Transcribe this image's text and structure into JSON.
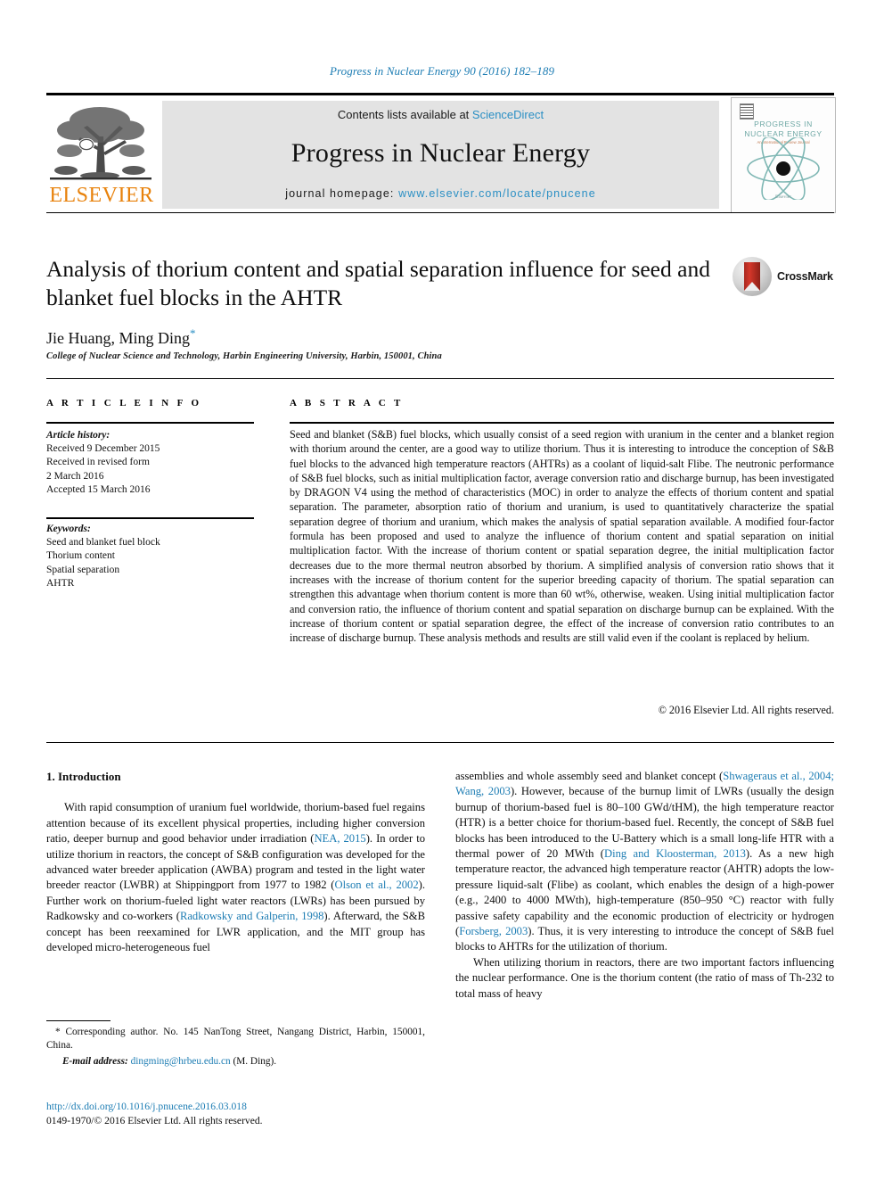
{
  "running_head": "Progress in Nuclear Energy 90 (2016) 182–189",
  "masthead": {
    "contents_prefix": "Contents lists available at ",
    "sciencedirect": "ScienceDirect",
    "journal_title": "Progress in Nuclear Energy",
    "homepage_prefix": "journal homepage: ",
    "homepage_url": "www.elsevier.com/locate/pnucene",
    "publisher": "ELSEVIER",
    "cover": {
      "line1": "PROGRESS IN",
      "line2": "NUCLEAR ENERGY",
      "subtitle": "An International Review Journal",
      "publisher_mark": "Elsevier"
    },
    "sciencedirect_color": "#2a8fc4",
    "elsevier_orange": "#e8820c",
    "banner_bg": "#e3e3e3"
  },
  "article": {
    "title": "Analysis of thorium content and spatial separation influence for seed and blanket fuel blocks in the AHTR",
    "authors": "Jie Huang, Ming Ding",
    "corresponding_marker": "*",
    "affiliation": "College of Nuclear Science and Technology, Harbin Engineering University, Harbin, 150001, China",
    "crossmark_label": "CrossMark"
  },
  "info": {
    "heading": "A R T I C L E  I N F O",
    "history_label": "Article history:",
    "history": [
      "Received 9 December 2015",
      "Received in revised form",
      "2 March 2016",
      "Accepted 15 March 2016"
    ],
    "keywords_label": "Keywords:",
    "keywords": [
      "Seed and blanket fuel block",
      "Thorium content",
      "Spatial separation",
      "AHTR"
    ]
  },
  "abstract": {
    "heading": "A B S T R A C T",
    "text": "Seed and blanket (S&B) fuel blocks, which usually consist of a seed region with uranium in the center and a blanket region with thorium around the center, are a good way to utilize thorium. Thus it is interesting to introduce the conception of S&B fuel blocks to the advanced high temperature reactors (AHTRs) as a coolant of liquid-salt Flibe. The neutronic performance of S&B fuel blocks, such as initial multiplication factor, average conversion ratio and discharge burnup, has been investigated by DRAGON V4 using the method of characteristics (MOC) in order to analyze the effects of thorium content and spatial separation. The parameter, absorption ratio of thorium and uranium, is used to quantitatively characterize the spatial separation degree of thorium and uranium, which makes the analysis of spatial separation available. A modified four-factor formula has been proposed and used to analyze the influence of thorium content and spatial separation on initial multiplication factor. With the increase of thorium content or spatial separation degree, the initial multiplication factor decreases due to the more thermal neutron absorbed by thorium. A simplified analysis of conversion ratio shows that it increases with the increase of thorium content for the superior breeding capacity of thorium. The spatial separation can strengthen this advantage when thorium content is more than 60 wt%, otherwise, weaken. Using initial multiplication factor and conversion ratio, the influence of thorium content and spatial separation on discharge burnup can be explained. With the increase of thorium content or spatial separation degree, the effect of the increase of conversion ratio contributes to an increase of discharge burnup. These analysis methods and results are still valid even if the coolant is replaced by helium.",
    "copyright": "© 2016 Elsevier Ltd. All rights reserved."
  },
  "body": {
    "section_number_title": "1. Introduction",
    "left_paragraph_1_a": "With rapid consumption of uranium fuel worldwide, thorium-based fuel regains attention because of its excellent physical properties, including higher conversion ratio, deeper burnup and good behavior under irradiation (",
    "ref_nea": "NEA, 2015",
    "left_paragraph_1_b": "). In order to utilize thorium in reactors, the concept of S&B configuration was developed for the advanced water breeder application (AWBA) program and tested in the light water breeder reactor (LWBR) at Shippingport from 1977 to 1982 (",
    "ref_olson": "Olson et al., 2002",
    "left_paragraph_1_c": "). Further work on thorium-fueled light water reactors (LWRs) has been pursued by Radkowsky and co-workers (",
    "ref_radkowsky": "Radkowsky and Galperin, 1998",
    "left_paragraph_1_d": "). Afterward, the S&B concept has been reexamined for LWR application, and the MIT group has developed micro-heterogeneous fuel",
    "right_paragraph_1_a": "assemblies and whole assembly seed and blanket concept (",
    "ref_shwageraus": "Shwageraus et al., 2004; Wang, 2003",
    "right_paragraph_1_b": "). However, because of the burnup limit of LWRs (usually the design burnup of thorium-based fuel is 80–100 GWd/tHM), the high temperature reactor (HTR) is a better choice for thorium-based fuel. Recently, the concept of S&B fuel blocks has been introduced to the U-Battery which is a small long-life HTR with a thermal power of 20 MWth (",
    "ref_ding": "Ding and Kloosterman, 2013",
    "right_paragraph_1_c": "). As a new high temperature reactor, the advanced high temperature reactor (AHTR) adopts the low-pressure liquid-salt (Flibe) as coolant, which enables the design of a high-power (e.g., 2400 to 4000 MWth), high-temperature (850–950 °C) reactor with fully passive safety capability and the economic production of electricity or hydrogen (",
    "ref_forsberg": "Forsberg, 2003",
    "right_paragraph_1_d": "). Thus, it is very interesting to introduce the concept of S&B fuel blocks to AHTRs for the utilization of thorium.",
    "right_paragraph_2": "When utilizing thorium in reactors, there are two important factors influencing the nuclear performance. One is the thorium content (the ratio of mass of Th-232 to total mass of heavy",
    "link_color": "#1c7cb3"
  },
  "footer": {
    "corresponding_marker": "*",
    "corresponding_text": "Corresponding author. No. 145 NanTong Street, Nangang District, Harbin, 150001, China.",
    "email_label": "E-mail address:",
    "email": "dingming@hrbeu.edu.cn",
    "email_suffix": "(M. Ding).",
    "doi": "http://dx.doi.org/10.1016/j.pnucene.2016.03.018",
    "issn_line": "0149-1970/© 2016 Elsevier Ltd. All rights reserved."
  }
}
